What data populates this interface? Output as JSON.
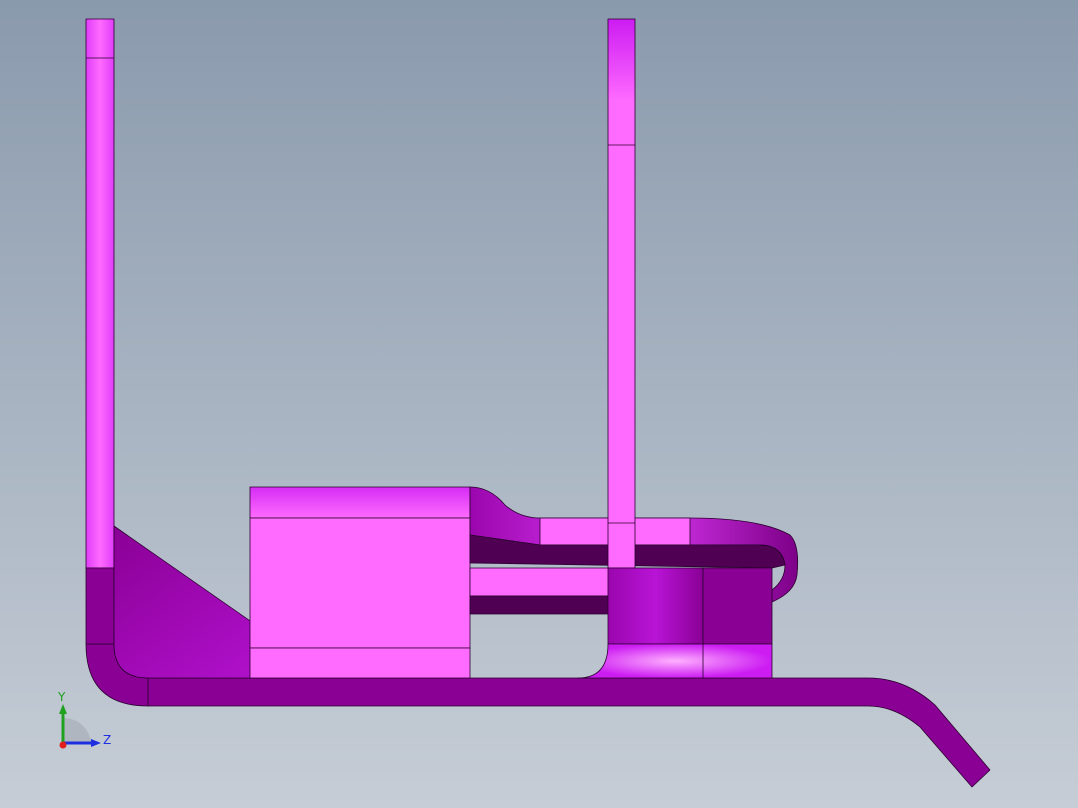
{
  "viewport": {
    "background_top": "#8a9aad",
    "background_bottom": "#c6cdd6"
  },
  "part": {
    "color_light": "#ff6bff",
    "color_mid": "#cc1cf2",
    "color_dark": "#8a0095",
    "color_darker": "#4f0052",
    "edge_color": "#2a002e"
  },
  "triad": {
    "y_label": "Y",
    "z_label": "Z",
    "y_color": "#1fa01f",
    "z_color": "#1f2fe0",
    "x_color": "#e01f1f"
  }
}
